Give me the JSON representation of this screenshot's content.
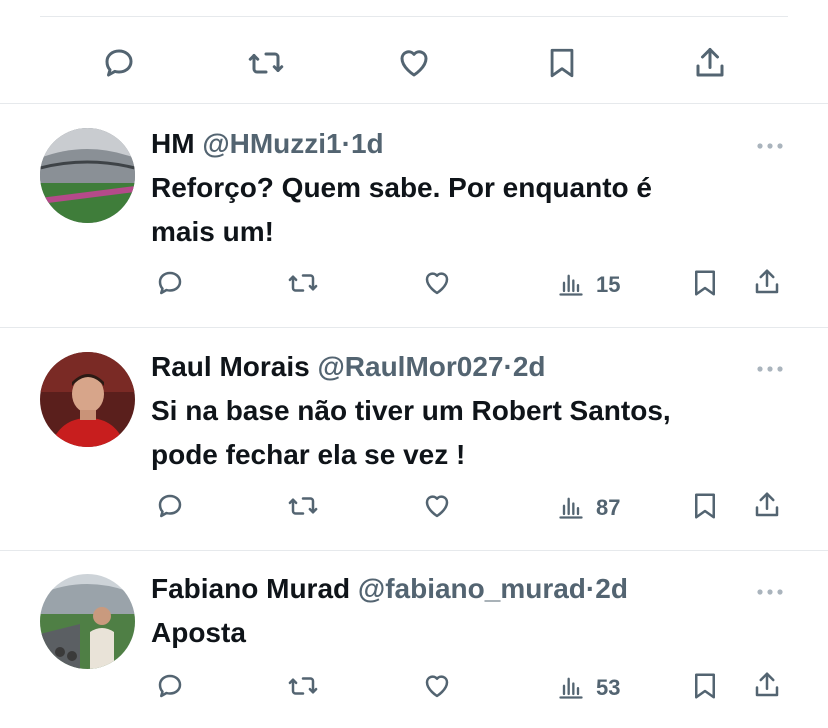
{
  "top_actions": [
    "reply-icon",
    "retweet-icon",
    "like-icon",
    "bookmark-icon",
    "share-icon"
  ],
  "replies": [
    {
      "name": "HM",
      "handle": "@HMuzzi1",
      "sep": "·",
      "time": "1d",
      "text_lines": [
        "Reforço? Quem sabe. Por enquanto é",
        "mais um!"
      ],
      "views": "15"
    },
    {
      "name": "Raul Morais",
      "handle": "@RaulMor027",
      "sep": "·",
      "time": "2d",
      "text_lines": [
        "Si na base não tiver um Robert Santos,",
        "pode fechar ela se vez !"
      ],
      "views": "87"
    },
    {
      "name": "Fabiano Murad",
      "handle": "@fabiano_murad",
      "sep": "·",
      "time": "2d",
      "text_lines": [
        "Aposta"
      ],
      "views": "53"
    }
  ],
  "colors": {
    "text": "#0f1419",
    "secondary": "#536471",
    "divider": "#e6e9ec"
  }
}
